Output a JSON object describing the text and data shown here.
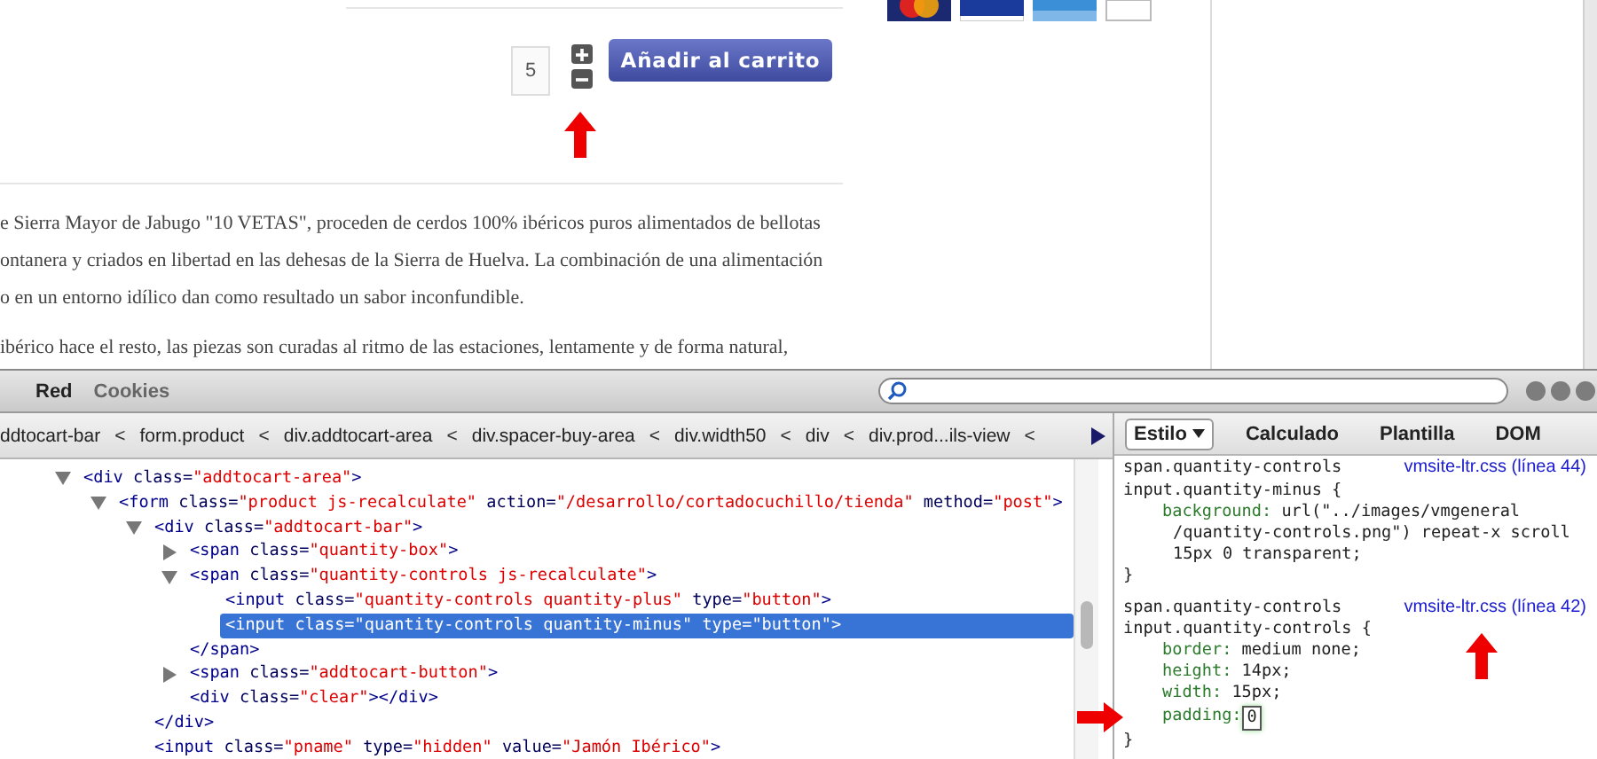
{
  "page": {
    "quantity": {
      "value": "5"
    },
    "quantity_marked": true,
    "add_to_cart": "Añadir al carrito",
    "paragraphs": [
      [
        "e Sierra Mayor de Jabugo \"10 VETAS\", proceden de cerdos 100% ibéricos puros alimentados de bellotas",
        "ontanera y criados en libertad en las dehesas de la Sierra de Huelva. La combinación de una alimentación",
        "o en un entorno idílico dan como resultado un sabor inconfundible."
      ],
      [
        "ibérico hace el resto, las piezas son curadas al ritmo de las estaciones, lentamente y de forma natural,"
      ]
    ]
  },
  "devtools": {
    "panel_tabs": [
      {
        "label": "Red",
        "highlighted": true
      },
      {
        "label": "Cookies",
        "highlighted": false
      }
    ],
    "breadcrumbs": [
      {
        "label": "ddtocart-bar",
        "separator": "<"
      },
      {
        "label": "form.product",
        "separator": "<"
      },
      {
        "label": "div.addtocart-area",
        "separator": "<"
      },
      {
        "label": "div.spacer-buy-area",
        "separator": "<"
      },
      {
        "label": "div.width50",
        "separator": "<"
      },
      {
        "label": "div",
        "separator": "<"
      },
      {
        "label": "div.prod...ils-view",
        "separator": "<"
      }
    ],
    "side_tabs": [
      {
        "label": "Estilo",
        "selected": true,
        "menu": true
      },
      {
        "label": "Calculado",
        "selected": false,
        "menu": false
      },
      {
        "label": "Plantilla",
        "selected": false,
        "menu": false
      },
      {
        "label": "DOM",
        "selected": false,
        "menu": false
      }
    ],
    "html_tree": [
      {
        "kind": "branch",
        "expanded": true,
        "selected": false,
        "tokens": [
          {
            "kind": "tag",
            "text": "<div"
          },
          {
            "kind": "attr",
            "text": " class="
          },
          {
            "kind": "value",
            "text": "\"addtocart-area\""
          },
          {
            "kind": "tag",
            "text": ">"
          }
        ],
        "children": [
          {
            "kind": "branch",
            "expanded": true,
            "selected": false,
            "tokens": [
              {
                "kind": "tag",
                "text": "<form"
              },
              {
                "kind": "attr",
                "text": " class="
              },
              {
                "kind": "value",
                "text": "\"product js-recalculate\""
              },
              {
                "kind": "attr",
                "text": " action="
              },
              {
                "kind": "value",
                "text": "\"/desarrollo/cortadocuchillo/tienda\""
              },
              {
                "kind": "attr",
                "text": " method="
              },
              {
                "kind": "value",
                "text": "\"post\""
              },
              {
                "kind": "tag",
                "text": ">"
              }
            ],
            "children": [
              {
                "kind": "branch",
                "expanded": true,
                "selected": false,
                "tokens": [
                  {
                    "kind": "tag",
                    "text": "<div"
                  },
                  {
                    "kind": "attr",
                    "text": " class="
                  },
                  {
                    "kind": "value",
                    "text": "\"addtocart-bar\""
                  },
                  {
                    "kind": "tag",
                    "text": ">"
                  }
                ],
                "close": [
                  {
                    "kind": "tag",
                    "text": "</div>"
                  }
                ],
                "children": [
                  {
                    "kind": "branch",
                    "expanded": false,
                    "selected": false,
                    "tokens": [
                      {
                        "kind": "tag",
                        "text": "<span"
                      },
                      {
                        "kind": "attr",
                        "text": " class="
                      },
                      {
                        "kind": "value",
                        "text": "\"quantity-box\""
                      },
                      {
                        "kind": "tag",
                        "text": ">"
                      }
                    ]
                  },
                  {
                    "kind": "branch",
                    "expanded": true,
                    "selected": false,
                    "tokens": [
                      {
                        "kind": "tag",
                        "text": "<span"
                      },
                      {
                        "kind": "attr",
                        "text": " class="
                      },
                      {
                        "kind": "value",
                        "text": "\"quantity-controls js-recalculate\""
                      },
                      {
                        "kind": "tag",
                        "text": ">"
                      }
                    ],
                    "close": [
                      {
                        "kind": "tag",
                        "text": "</span>"
                      }
                    ],
                    "children": [
                      {
                        "kind": "leaf",
                        "selected": false,
                        "tokens": [
                          {
                            "kind": "tag",
                            "text": "<input"
                          },
                          {
                            "kind": "attr",
                            "text": " class="
                          },
                          {
                            "kind": "value",
                            "text": "\"quantity-controls quantity-plus\""
                          },
                          {
                            "kind": "attr",
                            "text": " type="
                          },
                          {
                            "kind": "value",
                            "text": "\"button\""
                          },
                          {
                            "kind": "tag",
                            "text": ">"
                          }
                        ]
                      },
                      {
                        "kind": "leaf",
                        "selected": true,
                        "tokens": [
                          {
                            "kind": "tag",
                            "text": "<input"
                          },
                          {
                            "kind": "attr",
                            "text": " class="
                          },
                          {
                            "kind": "value",
                            "text": "\"quantity-controls quantity-minus\""
                          },
                          {
                            "kind": "attr",
                            "text": " type="
                          },
                          {
                            "kind": "value",
                            "text": "\"button\""
                          },
                          {
                            "kind": "tag",
                            "text": ">"
                          }
                        ]
                      }
                    ]
                  },
                  {
                    "kind": "branch",
                    "expanded": false,
                    "selected": false,
                    "tokens": [
                      {
                        "kind": "tag",
                        "text": "<span"
                      },
                      {
                        "kind": "attr",
                        "text": " class="
                      },
                      {
                        "kind": "value",
                        "text": "\"addtocart-button\""
                      },
                      {
                        "kind": "tag",
                        "text": ">"
                      }
                    ]
                  },
                  {
                    "kind": "leaf",
                    "selected": false,
                    "tokens": [
                      {
                        "kind": "tag",
                        "text": "<div"
                      },
                      {
                        "kind": "attr",
                        "text": " class="
                      },
                      {
                        "kind": "value",
                        "text": "\"clear\""
                      },
                      {
                        "kind": "tag",
                        "text": "></div>"
                      }
                    ]
                  }
                ]
              },
              {
                "kind": "leaf",
                "selected": false,
                "tokens": [
                  {
                    "kind": "tag",
                    "text": "<input"
                  },
                  {
                    "kind": "attr",
                    "text": " class="
                  },
                  {
                    "kind": "value",
                    "text": "\"pname\""
                  },
                  {
                    "kind": "attr",
                    "text": " type="
                  },
                  {
                    "kind": "value",
                    "text": "\"hidden\""
                  },
                  {
                    "kind": "attr",
                    "text": " value="
                  },
                  {
                    "kind": "value",
                    "text": "\"Jamón Ibérico\""
                  },
                  {
                    "kind": "tag",
                    "text": ">"
                  }
                ]
              }
            ]
          }
        ]
      }
    ],
    "css_rules": [
      {
        "selector": [
          "span.quantity-controls",
          "input.quantity-minus {"
        ],
        "source": "vmsite-ltr.css (línea 44)",
        "properties": [
          {
            "name": "background:",
            "value": "url(\"../images/vmgeneral /quantity-controls.png\") repeat-x scroll 15px 0 transparent;",
            "editing": false
          }
        ],
        "close": "}"
      },
      {
        "selector": [
          "span.quantity-controls",
          "input.quantity-controls {"
        ],
        "source": "vmsite-ltr.css (línea 42)",
        "marked": true,
        "properties": [
          {
            "name": "border:",
            "value": "medium none;",
            "editing": false
          },
          {
            "name": "height:",
            "value": "14px;",
            "editing": false
          },
          {
            "name": "width:",
            "value": "15px;",
            "editing": false
          },
          {
            "name": "padding:",
            "value": "0",
            "editing": true,
            "marked": true
          }
        ],
        "close": "}"
      }
    ]
  }
}
